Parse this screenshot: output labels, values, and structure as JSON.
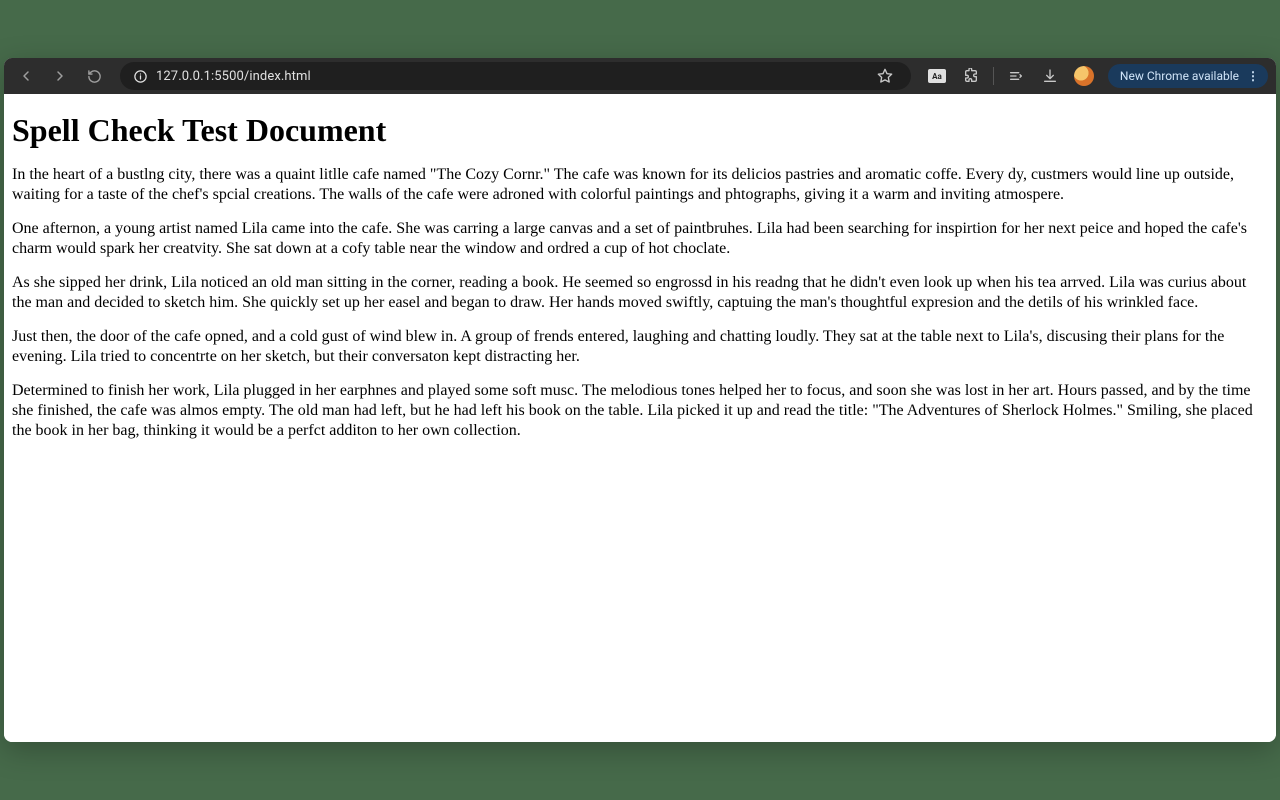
{
  "browser": {
    "url": "127.0.0.1:5500/index.html",
    "update_label": "New Chrome available"
  },
  "document": {
    "title": "Spell Check Test Document",
    "paragraphs": [
      "In the heart of a bustlng city, there was a quaint litlle cafe named \"The Cozy Cornr.\" The cafe was known for its delicios pastries and aromatic coffe. Every dy, custmers would line up outside, waiting for a taste of the chef's spcial creations. The walls of the cafe were adroned with colorful paintings and phtographs, giving it a warm and inviting atmospere.",
      "One afternon, a young artist named Lila came into the cafe. She was carring a large canvas and a set of paintbruhes. Lila had been searching for inspirtion for her next peice and hoped the cafe's charm would spark her creatvity. She sat down at a cofy table near the window and ordred a cup of hot choclate.",
      "As she sipped her drink, Lila noticed an old man sitting in the corner, reading a book. He seemed so engrossd in his readng that he didn't even look up when his tea arrved. Lila was curius about the man and decided to sketch him. She quickly set up her easel and began to draw. Her hands moved swiftly, captuing the man's thoughtful expresion and the detils of his wrinkled face.",
      "Just then, the door of the cafe opned, and a cold gust of wind blew in. A group of frends entered, laughing and chatting loudly. They sat at the table next to Lila's, discusing their plans for the evening. Lila tried to concentrte on her sketch, but their conversaton kept distracting her.",
      "Determined to finish her work, Lila plugged in her earphnes and played some soft musc. The melodious tones helped her to focus, and soon she was lost in her art. Hours passed, and by the time she finished, the cafe was almos empty. The old man had left, but he had left his book on the table. Lila picked it up and read the title: \"The Adventures of Sherlock Holmes.\" Smiling, she placed the book in her bag, thinking it would be a perfct additon to her own collection."
    ]
  }
}
